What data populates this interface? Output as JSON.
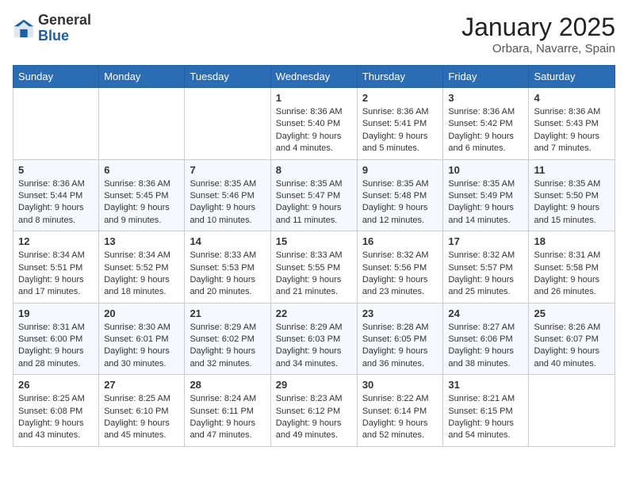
{
  "header": {
    "logo": {
      "general": "General",
      "blue": "Blue"
    },
    "title": "January 2025",
    "location": "Orbara, Navarre, Spain"
  },
  "calendar": {
    "columns": [
      "Sunday",
      "Monday",
      "Tuesday",
      "Wednesday",
      "Thursday",
      "Friday",
      "Saturday"
    ],
    "weeks": [
      [
        {
          "day": "",
          "content": ""
        },
        {
          "day": "",
          "content": ""
        },
        {
          "day": "",
          "content": ""
        },
        {
          "day": "1",
          "content": "Sunrise: 8:36 AM\nSunset: 5:40 PM\nDaylight: 9 hours\nand 4 minutes."
        },
        {
          "day": "2",
          "content": "Sunrise: 8:36 AM\nSunset: 5:41 PM\nDaylight: 9 hours\nand 5 minutes."
        },
        {
          "day": "3",
          "content": "Sunrise: 8:36 AM\nSunset: 5:42 PM\nDaylight: 9 hours\nand 6 minutes."
        },
        {
          "day": "4",
          "content": "Sunrise: 8:36 AM\nSunset: 5:43 PM\nDaylight: 9 hours\nand 7 minutes."
        }
      ],
      [
        {
          "day": "5",
          "content": "Sunrise: 8:36 AM\nSunset: 5:44 PM\nDaylight: 9 hours\nand 8 minutes."
        },
        {
          "day": "6",
          "content": "Sunrise: 8:36 AM\nSunset: 5:45 PM\nDaylight: 9 hours\nand 9 minutes."
        },
        {
          "day": "7",
          "content": "Sunrise: 8:35 AM\nSunset: 5:46 PM\nDaylight: 9 hours\nand 10 minutes."
        },
        {
          "day": "8",
          "content": "Sunrise: 8:35 AM\nSunset: 5:47 PM\nDaylight: 9 hours\nand 11 minutes."
        },
        {
          "day": "9",
          "content": "Sunrise: 8:35 AM\nSunset: 5:48 PM\nDaylight: 9 hours\nand 12 minutes."
        },
        {
          "day": "10",
          "content": "Sunrise: 8:35 AM\nSunset: 5:49 PM\nDaylight: 9 hours\nand 14 minutes."
        },
        {
          "day": "11",
          "content": "Sunrise: 8:35 AM\nSunset: 5:50 PM\nDaylight: 9 hours\nand 15 minutes."
        }
      ],
      [
        {
          "day": "12",
          "content": "Sunrise: 8:34 AM\nSunset: 5:51 PM\nDaylight: 9 hours\nand 17 minutes."
        },
        {
          "day": "13",
          "content": "Sunrise: 8:34 AM\nSunset: 5:52 PM\nDaylight: 9 hours\nand 18 minutes."
        },
        {
          "day": "14",
          "content": "Sunrise: 8:33 AM\nSunset: 5:53 PM\nDaylight: 9 hours\nand 20 minutes."
        },
        {
          "day": "15",
          "content": "Sunrise: 8:33 AM\nSunset: 5:55 PM\nDaylight: 9 hours\nand 21 minutes."
        },
        {
          "day": "16",
          "content": "Sunrise: 8:32 AM\nSunset: 5:56 PM\nDaylight: 9 hours\nand 23 minutes."
        },
        {
          "day": "17",
          "content": "Sunrise: 8:32 AM\nSunset: 5:57 PM\nDaylight: 9 hours\nand 25 minutes."
        },
        {
          "day": "18",
          "content": "Sunrise: 8:31 AM\nSunset: 5:58 PM\nDaylight: 9 hours\nand 26 minutes."
        }
      ],
      [
        {
          "day": "19",
          "content": "Sunrise: 8:31 AM\nSunset: 6:00 PM\nDaylight: 9 hours\nand 28 minutes."
        },
        {
          "day": "20",
          "content": "Sunrise: 8:30 AM\nSunset: 6:01 PM\nDaylight: 9 hours\nand 30 minutes."
        },
        {
          "day": "21",
          "content": "Sunrise: 8:29 AM\nSunset: 6:02 PM\nDaylight: 9 hours\nand 32 minutes."
        },
        {
          "day": "22",
          "content": "Sunrise: 8:29 AM\nSunset: 6:03 PM\nDaylight: 9 hours\nand 34 minutes."
        },
        {
          "day": "23",
          "content": "Sunrise: 8:28 AM\nSunset: 6:05 PM\nDaylight: 9 hours\nand 36 minutes."
        },
        {
          "day": "24",
          "content": "Sunrise: 8:27 AM\nSunset: 6:06 PM\nDaylight: 9 hours\nand 38 minutes."
        },
        {
          "day": "25",
          "content": "Sunrise: 8:26 AM\nSunset: 6:07 PM\nDaylight: 9 hours\nand 40 minutes."
        }
      ],
      [
        {
          "day": "26",
          "content": "Sunrise: 8:25 AM\nSunset: 6:08 PM\nDaylight: 9 hours\nand 43 minutes."
        },
        {
          "day": "27",
          "content": "Sunrise: 8:25 AM\nSunset: 6:10 PM\nDaylight: 9 hours\nand 45 minutes."
        },
        {
          "day": "28",
          "content": "Sunrise: 8:24 AM\nSunset: 6:11 PM\nDaylight: 9 hours\nand 47 minutes."
        },
        {
          "day": "29",
          "content": "Sunrise: 8:23 AM\nSunset: 6:12 PM\nDaylight: 9 hours\nand 49 minutes."
        },
        {
          "day": "30",
          "content": "Sunrise: 8:22 AM\nSunset: 6:14 PM\nDaylight: 9 hours\nand 52 minutes."
        },
        {
          "day": "31",
          "content": "Sunrise: 8:21 AM\nSunset: 6:15 PM\nDaylight: 9 hours\nand 54 minutes."
        },
        {
          "day": "",
          "content": ""
        }
      ]
    ]
  }
}
